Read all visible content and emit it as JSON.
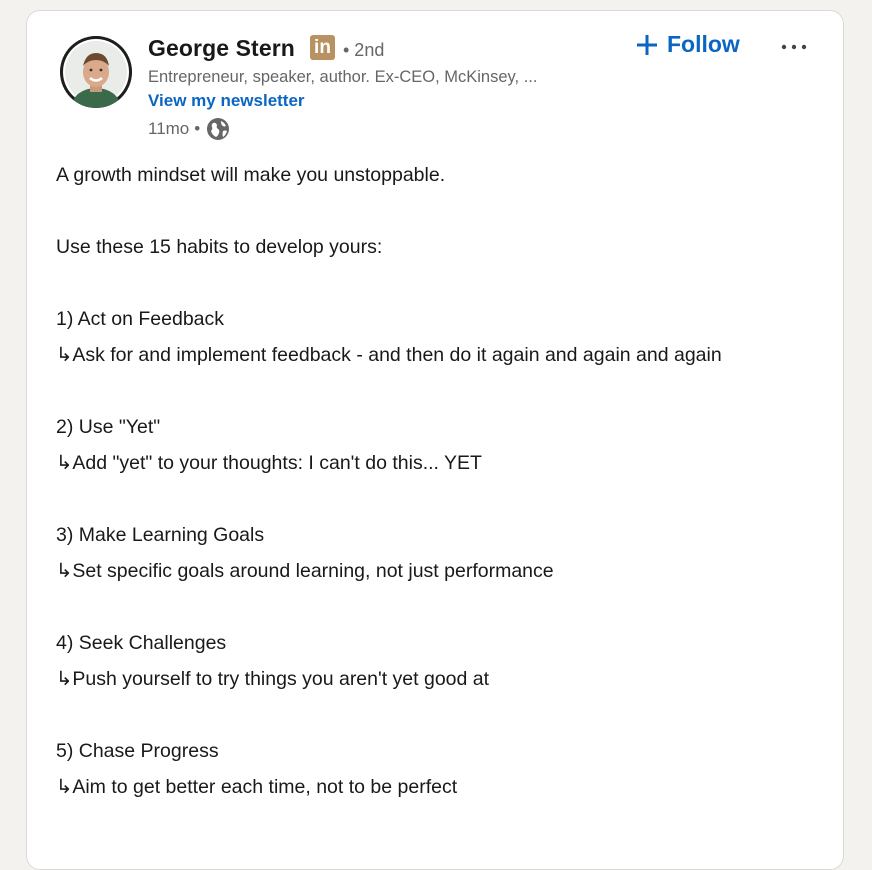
{
  "author": {
    "name": "George Stern",
    "badge": "in",
    "degree": "• 2nd",
    "headline": "Entrepreneur, speaker, author. Ex-CEO, McKinsey, ...",
    "newsletter_link": "View my newsletter",
    "time": "11mo",
    "meta_dot": "•",
    "visibility_icon": "globe-icon"
  },
  "actions": {
    "follow_label": "Follow",
    "follow_icon": "plus-icon",
    "more_icon": "ellipsis-icon"
  },
  "post": {
    "intro": "A growth mindset will make you unstoppable.",
    "lead": "Use these 15 habits to develop yours:",
    "habits": [
      {
        "title": "1) Act on Feedback",
        "detail": "↳Ask for and implement feedback - and then do it again and again and again"
      },
      {
        "title": "2) Use \"Yet\"",
        "detail": "↳Add \"yet\" to your thoughts: I can't do this... YET"
      },
      {
        "title": "3) Make Learning Goals",
        "detail": "↳Set specific goals around learning, not just performance"
      },
      {
        "title": "4) Seek Challenges",
        "detail": "↳Push yourself to try things you aren't yet good at"
      },
      {
        "title": "5) Chase Progress",
        "detail": "↳Aim to get better each time, not to be perfect"
      }
    ]
  },
  "colors": {
    "link_blue": "#0a66c2",
    "badge_gold": "#b89263",
    "page_bg": "#f4f2ee"
  }
}
